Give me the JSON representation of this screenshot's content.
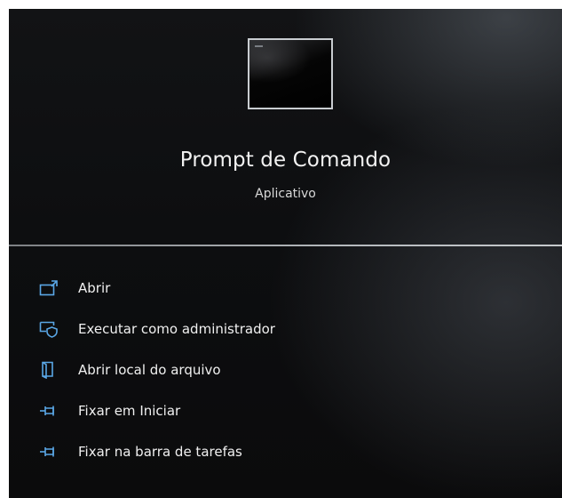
{
  "app": {
    "name": "Prompt de Comando",
    "type": "Aplicativo",
    "icon": "command-prompt-icon"
  },
  "menu": {
    "items": [
      {
        "label": "Abrir",
        "icon": "open-icon"
      },
      {
        "label": "Executar como administrador",
        "icon": "run-as-admin-icon"
      },
      {
        "label": "Abrir local do arquivo",
        "icon": "file-location-icon"
      },
      {
        "label": "Fixar em Iniciar",
        "icon": "pin-icon"
      },
      {
        "label": "Fixar na barra de tarefas",
        "icon": "pin-icon"
      }
    ]
  },
  "colors": {
    "accent_icon": "#5aa7e6",
    "background": "#0d0e10",
    "text": "#f0f0f0"
  }
}
